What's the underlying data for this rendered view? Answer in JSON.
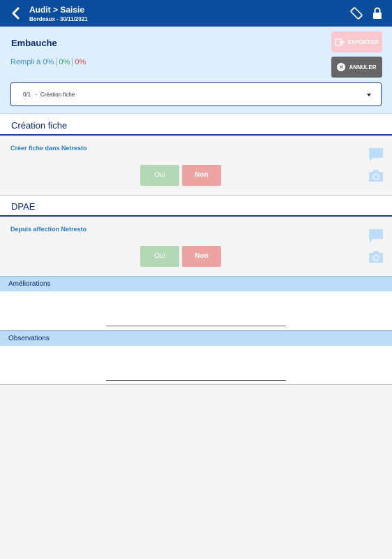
{
  "topbar": {
    "title": "Audit > Saisie",
    "subtitle": "Bordeaux - 30/11/2021",
    "back_icon": "chevron-left-icon",
    "rotate_icon": "screen-rotation-icon",
    "lock_icon": "lock-icon"
  },
  "header": {
    "form_title": "Embauche",
    "fill_label": "Rempli à 0%",
    "fill_ok": "0%",
    "fill_ko": "0%",
    "export_label": "EXPORTER",
    "cancel_label": "ANNULER",
    "section_select": {
      "index": "0/1",
      "separator": "-",
      "value": "Création fiche"
    }
  },
  "sections": [
    {
      "title": "Création fiche",
      "question": "Créer fiche dans Netresto",
      "yes_label": "Oui",
      "no_label": "Non"
    },
    {
      "title": "DPAE",
      "question": "Depuis affection Netresto",
      "yes_label": "Oui",
      "no_label": "Non"
    }
  ],
  "notes": {
    "improvements_label": "Améliorations",
    "observations_label": "Observations"
  },
  "colors": {
    "topbar": "#0a4d9c",
    "header_bg": "#ddeeff",
    "accent": "#1a3f8a",
    "yes_button": "#b2d8b6",
    "no_button": "#eea3a3",
    "export_button": "#f9c9cf",
    "cancel_button": "#666666"
  }
}
